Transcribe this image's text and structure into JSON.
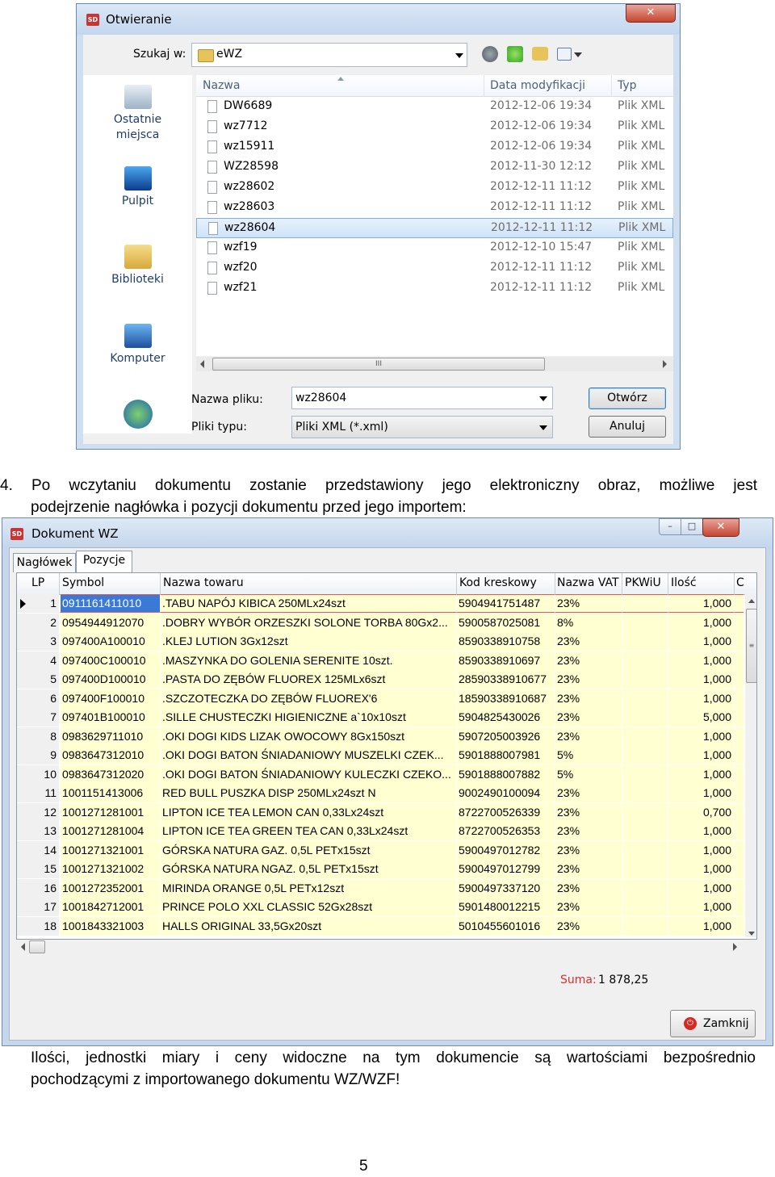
{
  "open_dialog": {
    "title": "Otwieranie",
    "look_in_label": "Szukaj w:",
    "look_in_value": "eWZ",
    "places": [
      {
        "label": "Ostatnie\nmiejsca",
        "icon": "recent-places-icon"
      },
      {
        "label": "Pulpit",
        "icon": "desktop-icon"
      },
      {
        "label": "Biblioteki",
        "icon": "libraries-icon"
      },
      {
        "label": "Komputer",
        "icon": "computer-icon"
      },
      {
        "label": "",
        "icon": "network-icon"
      }
    ],
    "columns": {
      "name": "Nazwa",
      "date": "Data modyfikacji",
      "type": "Typ"
    },
    "files": [
      {
        "name": "DW6689",
        "date": "2012-12-06 19:34",
        "type": "Plik XML"
      },
      {
        "name": "wz7712",
        "date": "2012-12-06 19:34",
        "type": "Plik XML"
      },
      {
        "name": "wz15911",
        "date": "2012-12-06 19:34",
        "type": "Plik XML"
      },
      {
        "name": "WZ28598",
        "date": "2012-11-30 12:12",
        "type": "Plik XML"
      },
      {
        "name": "wz28602",
        "date": "2012-12-11 11:12",
        "type": "Plik XML"
      },
      {
        "name": "wz28603",
        "date": "2012-12-11 11:12",
        "type": "Plik XML"
      },
      {
        "name": "wz28604",
        "date": "2012-12-11 11:12",
        "type": "Plik XML",
        "selected": true
      },
      {
        "name": "wzf19",
        "date": "2012-12-10 15:47",
        "type": "Plik XML"
      },
      {
        "name": "wzf20",
        "date": "2012-12-11 11:12",
        "type": "Plik XML"
      },
      {
        "name": "wzf21",
        "date": "2012-12-11 11:12",
        "type": "Plik XML"
      }
    ],
    "filename_label": "Nazwa pliku:",
    "filename_value": "wz28604",
    "filetype_label": "Pliki typu:",
    "filetype_value": "Pliki XML (*.xml)",
    "open_button": "Otwórz",
    "cancel_button": "Anuluj",
    "scroll_grip": "III"
  },
  "text": {
    "para1_line1": "4.  Po  wczytaniu  dokumentu  zostanie  przedstawiony  jego  elektroniczny  obraz,  możliwe  jest",
    "para1_line2": "podejrzenie nagłówka i pozycji dokumentu przed jego importem:",
    "para2_line1": "Ilości,  jednostki  miary  i  ceny  widoczne  na  tym  dokumencie  są  wartościami  bezpośrednio",
    "para2_line2": "pochodzącymi z importowanego dokumentu WZ/WZF!",
    "page_number": "5"
  },
  "wz_window": {
    "title": "Dokument WZ",
    "tabs": [
      "Nagłówek",
      "Pozycje"
    ],
    "active_tab": 1,
    "columns": {
      "lp": "LP",
      "symbol": "Symbol",
      "name": "Nazwa towaru",
      "barcode": "Kod kreskowy",
      "vat": "Nazwa VAT",
      "pkwiu": "PKWiU",
      "qty": "Ilość",
      "more": "C"
    },
    "rows": [
      {
        "lp": "1",
        "symbol": "0911161411010",
        "name": ".TABU NAPÓJ KIBICA 250MLx24szt",
        "barcode": "5904941751487",
        "vat": "23%",
        "qty": "1,000"
      },
      {
        "lp": "2",
        "symbol": "0954944912070",
        "name": ".DOBRY WYBÓR ORZESZKI SOLONE TORBA 80Gx2...",
        "barcode": "5900587025081",
        "vat": "8%",
        "qty": "1,000"
      },
      {
        "lp": "3",
        "symbol": "097400A100010",
        "name": ".KLEJ LUTION 3Gx12szt",
        "barcode": "8590338910758",
        "vat": "23%",
        "qty": "1,000"
      },
      {
        "lp": "4",
        "symbol": "097400C100010",
        "name": ".MASZYNKA DO GOLENIA SERENITE 10szt.",
        "barcode": "8590338910697",
        "vat": "23%",
        "qty": "1,000"
      },
      {
        "lp": "5",
        "symbol": "097400D100010",
        "name": ".PASTA DO ZĘBÓW FLUOREX 125MLx6szt",
        "barcode": "28590338910677",
        "vat": "23%",
        "qty": "1,000"
      },
      {
        "lp": "6",
        "symbol": "097400F100010",
        "name": ".SZCZOTECZKA DO ZĘBÓW FLUOREX'6",
        "barcode": "18590338910687",
        "vat": "23%",
        "qty": "1,000"
      },
      {
        "lp": "7",
        "symbol": "097401B100010",
        "name": ".SILLE CHUSTECZKI HIGIENICZNE a`10x10szt",
        "barcode": "5904825430026",
        "vat": "23%",
        "qty": "5,000"
      },
      {
        "lp": "8",
        "symbol": "0983629711010",
        "name": ".OKI DOGI KIDS LIZAK OWOCOWY 8Gx150szt",
        "barcode": "5907205003926",
        "vat": "23%",
        "qty": "1,000"
      },
      {
        "lp": "9",
        "symbol": "0983647312010",
        "name": ".OKI DOGI BATON ŚNIADANIOWY MUSZELKI CZEK...",
        "barcode": "5901888007981",
        "vat": "5%",
        "qty": "1,000"
      },
      {
        "lp": "10",
        "symbol": "0983647312020",
        "name": ".OKI DOGI BATON ŚNIADANIOWY KULECZKI CZEKO...",
        "barcode": "5901888007882",
        "vat": "5%",
        "qty": "1,000"
      },
      {
        "lp": "11",
        "symbol": "1001151413006",
        "name": "RED BULL PUSZKA DISP 250MLx24szt N",
        "barcode": "9002490100094",
        "vat": "23%",
        "qty": "1,000"
      },
      {
        "lp": "12",
        "symbol": "1001271281001",
        "name": "LIPTON ICE TEA LEMON CAN 0,33Lx24szt",
        "barcode": "8722700526339",
        "vat": "23%",
        "qty": "0,700"
      },
      {
        "lp": "13",
        "symbol": "1001271281004",
        "name": "LIPTON ICE TEA GREEN TEA CAN 0,33Lx24szt",
        "barcode": "8722700526353",
        "vat": "23%",
        "qty": "1,000"
      },
      {
        "lp": "14",
        "symbol": "1001271321001",
        "name": "GÓRSKA NATURA GAZ. 0,5L PETx15szt",
        "barcode": "5900497012782",
        "vat": "23%",
        "qty": "1,000"
      },
      {
        "lp": "15",
        "symbol": "1001271321002",
        "name": "GÓRSKA NATURA NGAZ. 0,5L PETx15szt",
        "barcode": "5900497012799",
        "vat": "23%",
        "qty": "1,000"
      },
      {
        "lp": "16",
        "symbol": "1001272352001",
        "name": "MIRINDA ORANGE 0,5L PETx12szt",
        "barcode": "5900497337120",
        "vat": "23%",
        "qty": "1,000"
      },
      {
        "lp": "17",
        "symbol": "1001842712001",
        "name": "PRINCE POLO XXL CLASSIC 52Gx28szt",
        "barcode": "5901480012215",
        "vat": "23%",
        "qty": "1,000"
      },
      {
        "lp": "18",
        "symbol": "1001843321003",
        "name": "HALLS ORIGINAL 33,5Gx20szt",
        "barcode": "5010455601016",
        "vat": "23%",
        "qty": "1,000"
      }
    ],
    "sum_label": "Suma:",
    "sum_value": "1 878,25",
    "close_button": "Zamknij"
  }
}
